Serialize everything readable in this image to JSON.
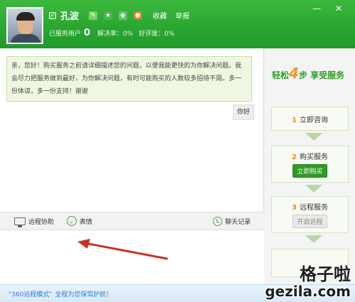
{
  "header": {
    "name": "孔波",
    "links": [
      "收藏",
      "举报"
    ],
    "served_label": "已服务用户",
    "served_count": "0",
    "resolve_rate": "解决率：0%",
    "rating": "好评度：0%",
    "close_symbol": "✕",
    "minimize_symbol": "—"
  },
  "chat": {
    "incoming_message": "亲，您好！购买服务之前请详细描述您的问题，以便我能更快的为你解决问题。我会尽力把服务做到最好，为你解决问题，有时可能购买的人数较多招待不周。多一份体谅，多一份支持！谢谢",
    "outgoing_message": "你好"
  },
  "toolbar": {
    "remote_assist": "远程协助",
    "emoji": "表情",
    "chat_history": "聊天记录"
  },
  "sidebar": {
    "title_prefix": "轻松",
    "title_number": "4",
    "title_mid": "步",
    "title_suffix": "享受服务",
    "steps": [
      {
        "number": "1",
        "label": "立即咨询"
      },
      {
        "number": "2",
        "label": "购买服务",
        "button": "立即购买"
      },
      {
        "number": "3",
        "label": "远程服务",
        "button": "开启远程"
      }
    ]
  },
  "footer": {
    "highlight": "\"360远程模式\"",
    "text": "全程为您保驾护航！"
  },
  "watermark": {
    "line1": "格子啦",
    "line2": "gezila.com"
  },
  "colors": {
    "header_green": "#2aa832",
    "accent_orange": "#f39a1b",
    "link_blue": "#2f7fd0",
    "arrow_red": "#c8322a"
  }
}
